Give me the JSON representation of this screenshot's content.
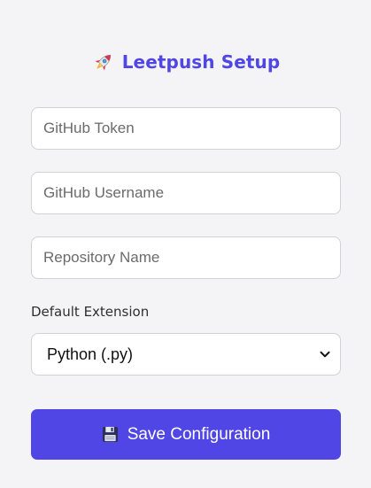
{
  "header": {
    "icon": "rocket-icon",
    "title": "Leetpush Setup",
    "accent_color": "#4f46e5"
  },
  "form": {
    "token_placeholder": "GitHub Token",
    "token_value": "",
    "username_placeholder": "GitHub Username",
    "username_value": "",
    "repo_placeholder": "Repository Name",
    "repo_value": "",
    "extension_label": "Default Extension",
    "extension_selected": "Python (.py)",
    "extension_icon": "chevron-down-icon"
  },
  "actions": {
    "save_icon": "floppy-disk-icon",
    "save_label": "Save Configuration",
    "save_color": "#4f46e5"
  }
}
